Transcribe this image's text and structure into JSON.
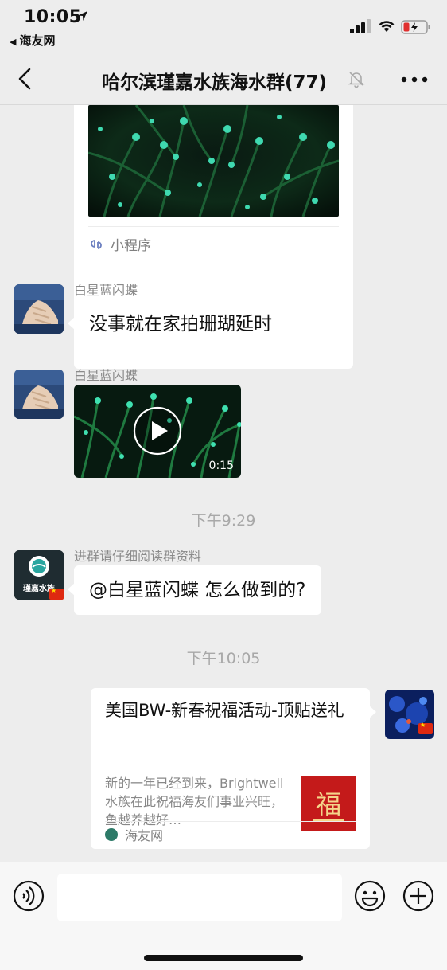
{
  "status_bar": {
    "time": "10:05",
    "back_app": "海友网"
  },
  "nav": {
    "title": "哈尔滨瑾嘉水族海水群(77)"
  },
  "messages": {
    "mini_program_label": "小程序",
    "msg1": {
      "sender": "白星蓝闪蝶",
      "text": "没事就在家拍珊瑚延时"
    },
    "msg2": {
      "sender": "白星蓝闪蝶",
      "video_duration": "0:15"
    },
    "ts1": "下午9:29",
    "msg3": {
      "sender": "进群请仔细阅读群资料",
      "avatar_text": "瑾嘉水族",
      "text": "@白星蓝闪蝶 怎么做到的?"
    },
    "ts2": "下午10:05",
    "msg4": {
      "title": "美国BW-新春祝福活动-顶贴送礼",
      "description": "新的一年已经到来，Brightwell水族在此祝福海友们事业兴旺，鱼越养越好…",
      "source": "海友网",
      "thumb_char": "福"
    }
  },
  "input_bar": {
    "placeholder": ""
  },
  "colors": {
    "background": "#ededed",
    "bubble": "#ffffff",
    "accent_red": "#c41a1a"
  }
}
